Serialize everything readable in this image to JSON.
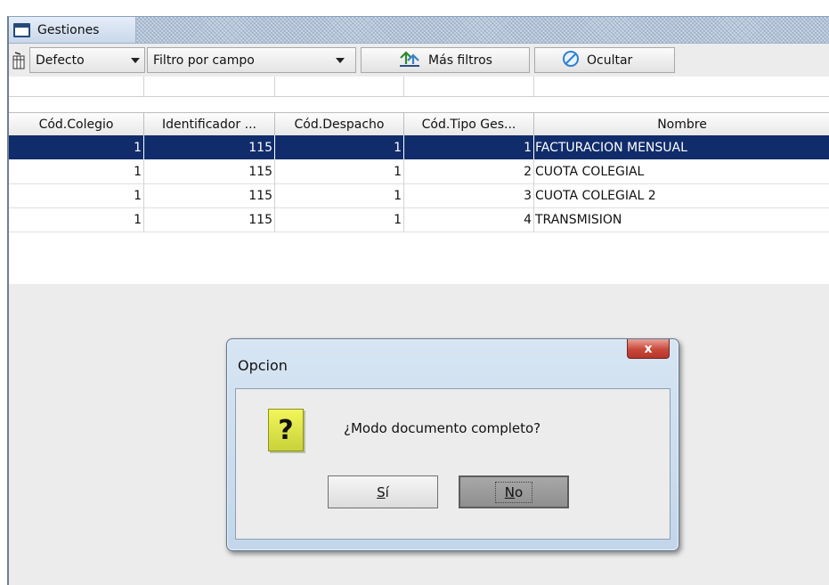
{
  "window": {
    "title": "Gestiones"
  },
  "toolbar": {
    "view_combo": "Defecto",
    "field_filter_combo": "Filtro por campo",
    "more_filters_button": "Más filtros",
    "hide_button": "Ocultar",
    "icons": {
      "column_selector": "column-selector-icon",
      "more_filters": "filter-arrows-icon",
      "hide": "no-entry-icon"
    }
  },
  "table": {
    "columns": [
      "Cód.Colegio",
      "Identificador ...",
      "Cód.Despacho",
      "Cód.Tipo Ges...",
      "Nombre"
    ],
    "rows": [
      {
        "cod_colegio": "1",
        "identificador": "115",
        "cod_despacho": "1",
        "cod_tipo": "1",
        "nombre": "FACTURACION MENSUAL",
        "selected": true
      },
      {
        "cod_colegio": "1",
        "identificador": "115",
        "cod_despacho": "1",
        "cod_tipo": "2",
        "nombre": "CUOTA COLEGIAL",
        "selected": false
      },
      {
        "cod_colegio": "1",
        "identificador": "115",
        "cod_despacho": "1",
        "cod_tipo": "3",
        "nombre": "CUOTA COLEGIAL 2",
        "selected": false
      },
      {
        "cod_colegio": "1",
        "identificador": "115",
        "cod_despacho": "1",
        "cod_tipo": "4",
        "nombre": "TRANSMISION",
        "selected": false
      }
    ]
  },
  "dialog": {
    "title": "Opcion",
    "close_label": "x",
    "icon": "question-icon",
    "icon_glyph": "?",
    "message": "¿Modo documento completo?",
    "yes_mnemonic": "S",
    "yes_rest": "í",
    "no_mnemonic": "N",
    "no_rest": "o"
  },
  "colors": {
    "selected_row": "#102c6b",
    "dialog_frame": "#c3d6ea",
    "close_button": "#c8483a",
    "question_icon": "#e8ee50"
  }
}
